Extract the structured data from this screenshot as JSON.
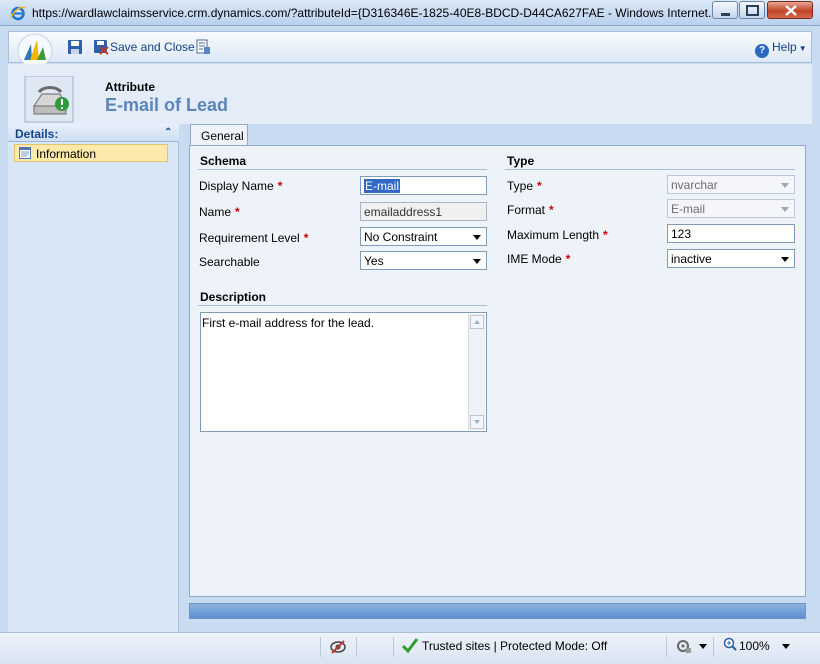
{
  "window": {
    "title": "https://wardlawclaimsservice.crm.dynamics.com/?attributeId={D316346E-1825-40E8-BDCD-D44CA627FAE - Windows Internet..."
  },
  "toolbar": {
    "save_close_label": "Save and Close",
    "help_label": "Help"
  },
  "header": {
    "entity_label": "Attribute",
    "record_title": "E-mail of Lead"
  },
  "nav": {
    "section_label": "Details:",
    "items": [
      {
        "label": "Information"
      }
    ]
  },
  "tabs": [
    {
      "label": "General"
    }
  ],
  "schema": {
    "section_title": "Schema",
    "display_name": {
      "label": "Display Name",
      "value": "E-mail"
    },
    "name": {
      "label": "Name",
      "value": "emailaddress1"
    },
    "requirement_level": {
      "label": "Requirement Level",
      "value": "No Constraint"
    },
    "searchable": {
      "label": "Searchable",
      "value": "Yes"
    }
  },
  "type_section": {
    "section_title": "Type",
    "type": {
      "label": "Type",
      "value": "nvarchar"
    },
    "format": {
      "label": "Format",
      "value": "E-mail"
    },
    "max_length": {
      "label": "Maximum Length",
      "value": "123"
    },
    "ime_mode": {
      "label": "IME Mode",
      "value": "inactive"
    }
  },
  "description": {
    "section_title": "Description",
    "value": "First e-mail address for the lead."
  },
  "required_marker": "*",
  "statusbar": {
    "zone_text": "Trusted sites | Protected Mode: Off",
    "zoom": "100%"
  },
  "colors": {
    "accent": "#15428b",
    "title_blue": "#5c85ba",
    "required_red": "#cc0000",
    "nav_selected": "#fde9a9"
  }
}
